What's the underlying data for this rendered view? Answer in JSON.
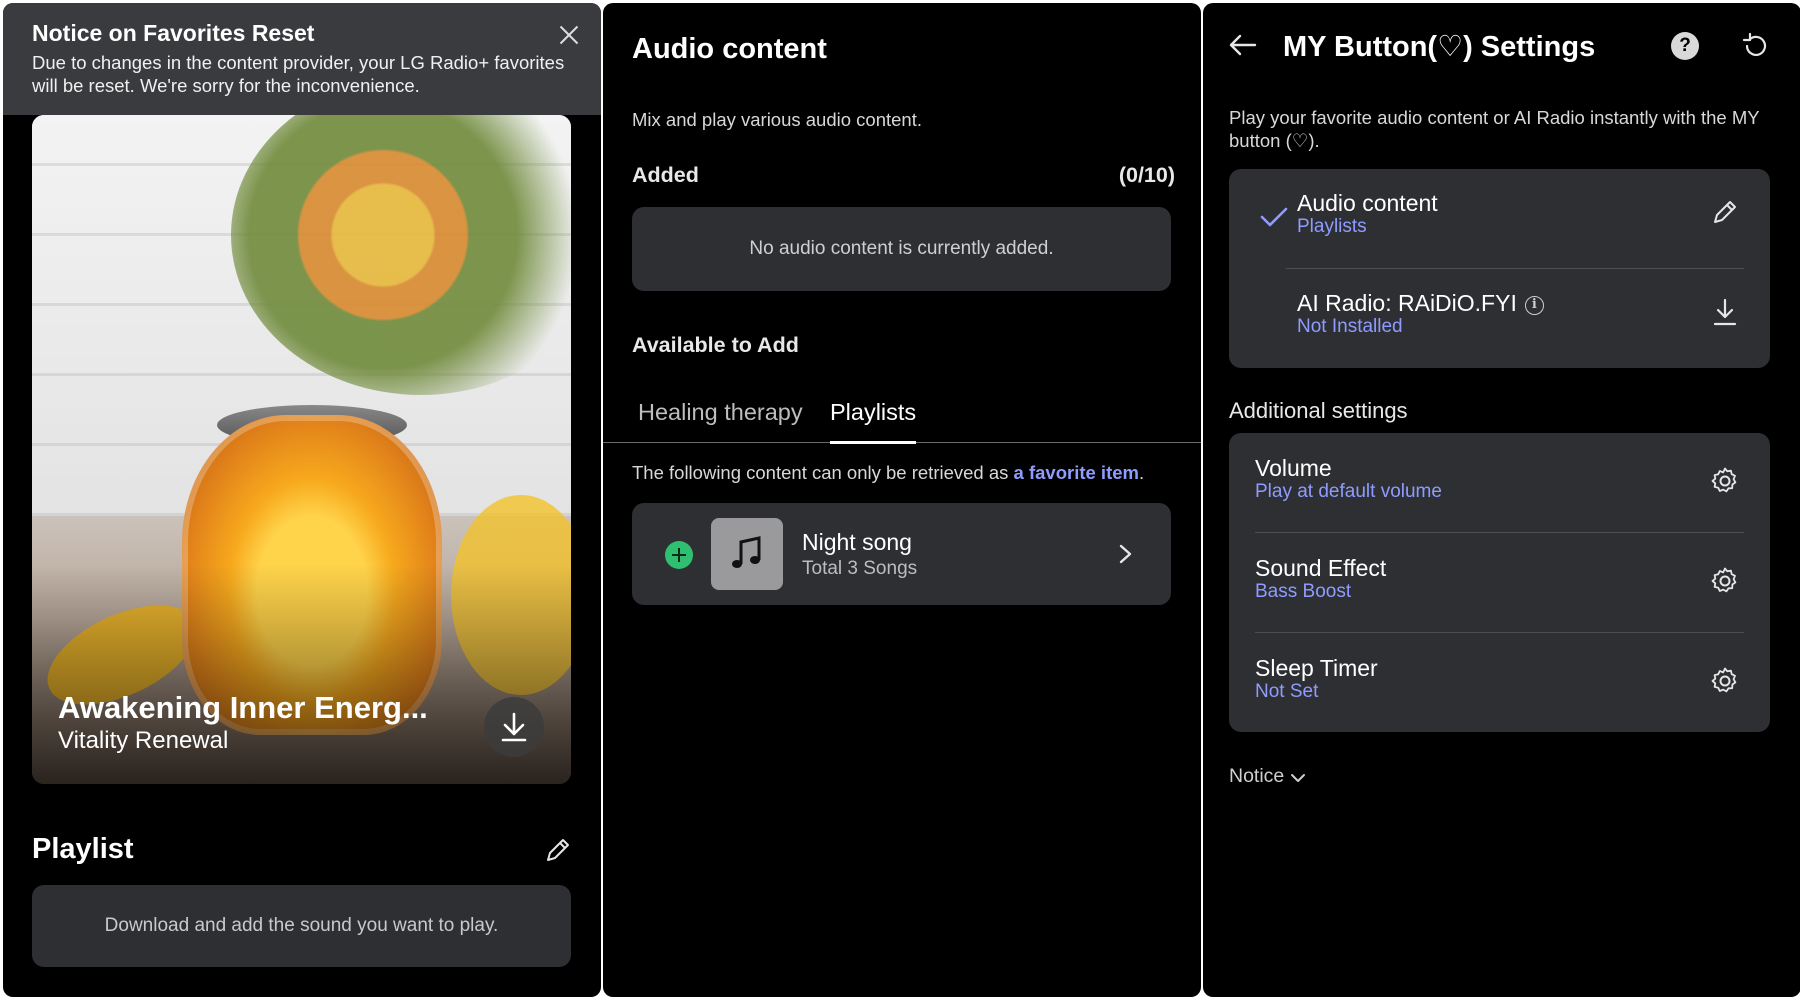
{
  "panel1": {
    "notice": {
      "title": "Notice on Favorites Reset",
      "text": "Due to changes in the content provider, your LG Radio+ favorites will be reset. We're sorry for the inconvenience.",
      "close_icon": "close-icon"
    },
    "hero": {
      "title": "Awakening Inner Energ...",
      "subtitle": "Vitality Renewal",
      "download_icon": "download-icon"
    },
    "playlist": {
      "heading": "Playlist",
      "edit_icon": "pencil-icon",
      "empty_text": "Download and add the sound you want to play."
    }
  },
  "panel2": {
    "title": "Audio content",
    "description": "Mix and play various audio content.",
    "added_label": "Added",
    "added_count": "(0/10)",
    "empty_text": "No audio content is currently added.",
    "available_label": "Available to Add",
    "tabs": [
      {
        "label": "Healing therapy",
        "active": false
      },
      {
        "label": "Playlists",
        "active": true
      }
    ],
    "info_prefix": "The following content can only be retrieved as ",
    "info_highlight": "a favorite item",
    "info_suffix": ".",
    "item": {
      "name": "Night song",
      "meta": "Total 3 Songs",
      "add_icon": "plus-circle-icon",
      "art_icon": "music-note-icon",
      "chevron_icon": "chevron-right-icon"
    }
  },
  "panel3": {
    "title": "MY Button(♡) Settings",
    "help_label": "?",
    "description": "Play your favorite audio content or AI Radio instantly with the MY button (♡).",
    "sources": [
      {
        "title": "Audio content",
        "subtitle": "Playlists",
        "selected": true,
        "action_icon": "pencil-icon"
      },
      {
        "title": "AI Radio: RAiDiO.FYI",
        "subtitle": "Not Installed",
        "selected": false,
        "action_icon": "download-icon",
        "info_label": "i"
      }
    ],
    "additional_label": "Additional settings",
    "settings": [
      {
        "title": "Volume",
        "subtitle": "Play at default volume"
      },
      {
        "title": "Sound Effect",
        "subtitle": "Bass Boost"
      },
      {
        "title": "Sleep Timer",
        "subtitle": "Not Set"
      }
    ],
    "notice_label": "Notice"
  },
  "colors": {
    "panel_bg": "#000000",
    "card_bg": "#2e2f33",
    "accent_text": "#8f9cff",
    "add_green": "#2fbf71"
  }
}
